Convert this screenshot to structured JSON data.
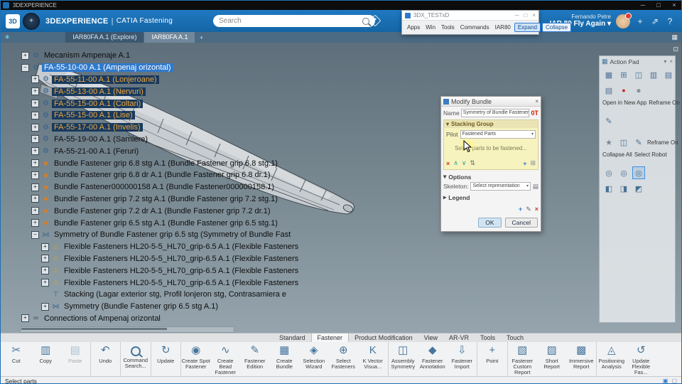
{
  "icons": {
    "minimize": "─",
    "maximize": "□",
    "close": "×",
    "caret_down": "▾",
    "caret_right": "▸",
    "plus": "+",
    "help": "?",
    "share": "⇗",
    "grid": "▦",
    "panel": "⊡",
    "home": "∗",
    "add_tab": "+",
    "logo": "3D",
    "compass": "+"
  },
  "titlebar": {
    "app": "3DEXPERIENCE"
  },
  "appbar": {
    "brand": "3DEXPERIENCE",
    "divider": "|",
    "app_name": "CATIA Fastening",
    "search_placeholder": "Search",
    "user_name": "Fernando Petre",
    "workspace": "IAR 80 Fly Again"
  },
  "floating_window": {
    "title": "3DX_TESTxD",
    "menus": [
      "Apps",
      "Win",
      "Tools",
      "Commands",
      "IAR80"
    ],
    "expand_label": "Expand",
    "collapse_label": "Collapse"
  },
  "view_tabs": {
    "items": [
      {
        "label": "IAR80FA A.1 (Explore)",
        "cls": ""
      },
      {
        "label": "IAR80FA A.1",
        "cls": "active"
      }
    ]
  },
  "tree": {
    "items": [
      {
        "label": "Mecanism Ampenaje A.1",
        "level": 1,
        "icon": "product",
        "exp": "plus",
        "cls": ""
      },
      {
        "label": "FA-55-10-00 A.1 (Ampenaj orizontal)",
        "level": 1,
        "icon": "product",
        "exp": "minus",
        "cls": "sel-bright"
      },
      {
        "label": "FA-55-11-00 A.1 (Lonjeroane)",
        "level": 2,
        "icon": "product",
        "exp": "plus",
        "cls": "sel-dark"
      },
      {
        "label": "FA-55-13-00 A.1 (Nervuri)",
        "level": 2,
        "icon": "product",
        "exp": "plus",
        "cls": "sel-dark"
      },
      {
        "label": "FA-55-15-00 A.1 (Coltari)",
        "level": 2,
        "icon": "product",
        "exp": "plus",
        "cls": "sel-dark"
      },
      {
        "label": "FA-55-15-00 A.1 (Lise)",
        "level": 2,
        "icon": "product",
        "exp": "plus",
        "cls": "sel-dark"
      },
      {
        "label": "FA-55-17-00 A.1 (Invelis)",
        "level": 2,
        "icon": "product",
        "exp": "plus",
        "cls": "sel-dark"
      },
      {
        "label": "FA-55-19-00 A.1 (Sarniere)",
        "level": 2,
        "icon": "product",
        "exp": "plus",
        "cls": ""
      },
      {
        "label": "FA-55-21-00 A.1 (Feruri)",
        "level": 2,
        "icon": "product",
        "exp": "plus",
        "cls": ""
      },
      {
        "label": "Bundle Fastener grip 6.8 stg A.1 (Bundle Fastener grip 6.8 stg.1)",
        "level": 2,
        "icon": "bundle",
        "exp": "plus",
        "cls": ""
      },
      {
        "label": "Bundle Fastener grip 6.8 dr A.1 (Bundle Fastener grip 6.8 dr.1)",
        "level": 2,
        "icon": "bundle",
        "exp": "plus",
        "cls": ""
      },
      {
        "label": "Bundle Fastener000000158 A.1 (Bundle Fastener000000158.1)",
        "level": 2,
        "icon": "bundle",
        "exp": "plus",
        "cls": ""
      },
      {
        "label": "Bundle Fastener grip 7.2 stg A.1 (Bundle Fastener grip 7.2 stg.1)",
        "level": 2,
        "icon": "bundle",
        "exp": "plus",
        "cls": ""
      },
      {
        "label": "Bundle Fastener grip 7.2 dr A.1 (Bundle Fastener grip 7.2 dr.1)",
        "level": 2,
        "icon": "bundle",
        "exp": "plus",
        "cls": ""
      },
      {
        "label": "Bundle Fastener grip 6.5 stg A.1 (Bundle Fastener grip 6.5 stg.1)",
        "level": 2,
        "icon": "bundle",
        "exp": "plus",
        "cls": ""
      },
      {
        "label": "Symmetry of Bundle Fastener grip 6.5 stg (Symmetry of Bundle Fast",
        "level": 2,
        "icon": "symmetry",
        "exp": "minus",
        "cls": ""
      },
      {
        "label": "Flexible Fasteners HL20-5-5_HL70_grip-6.5 A.1 (Flexible Fasteners",
        "level": 3,
        "icon": "flex",
        "exp": "plus",
        "cls": ""
      },
      {
        "label": "Flexible Fasteners HL20-5-5_HL70_grip-6.5 A.1 (Flexible Fasteners",
        "level": 3,
        "icon": "flex",
        "exp": "plus",
        "cls": ""
      },
      {
        "label": "Flexible Fasteners HL20-5-5_HL70_grip-6.5 A.1 (Flexible Fasteners",
        "level": 3,
        "icon": "flex",
        "exp": "plus",
        "cls": ""
      },
      {
        "label": "Flexible Fasteners HL20-5-5_HL70_grip-6.5 A.1 (Flexible Fasteners",
        "level": 3,
        "icon": "flex",
        "exp": "plus",
        "cls": ""
      },
      {
        "label": "Stacking (Lagar exterior stg, Profil lonjeron stg, Contrasamiera e",
        "level": 3,
        "icon": "stacking",
        "exp": "none",
        "cls": ""
      },
      {
        "label": "Symmetry (Bundle Fastener grip 6.5 stg A.1)",
        "level": 3,
        "icon": "symmetry",
        "exp": "plus",
        "cls": ""
      },
      {
        "label": "Connections of Ampenaj orizontal",
        "level": 1,
        "icon": "connections",
        "exp": "plus",
        "cls": ""
      }
    ]
  },
  "dialog": {
    "title": "Modify Bundle",
    "name_label": "Name",
    "name_value": "Symmetry of Bundle Fastener gri",
    "name_badge": "0T",
    "stacking_group_label": "Stacking Group",
    "pilot_label": "Pilot",
    "pilot_value": "Fastened Parts",
    "hint": "Select parts to be fastened...",
    "options_label": "Options",
    "skeleton_label": "Skeleton:",
    "skeleton_value": "Select representation",
    "legend_label": "Legend",
    "ok_label": "OK",
    "cancel_label": "Cancel"
  },
  "action_pad": {
    "title": "Action Pad",
    "open_in_new_app": "Open in New App",
    "reframe_on_a": "Reframe On",
    "reframe_on_b": "Reframe On",
    "collapse_all": "Collapse All",
    "select_robot": "Select Robot"
  },
  "ribbon": {
    "tabs": [
      {
        "label": "Standard",
        "cls": ""
      },
      {
        "label": "Fastener",
        "cls": "active"
      },
      {
        "label": "Product Modification",
        "cls": ""
      },
      {
        "label": "View",
        "cls": ""
      },
      {
        "label": "AR-VR",
        "cls": ""
      },
      {
        "label": "Tools",
        "cls": ""
      },
      {
        "label": "Touch",
        "cls": ""
      }
    ],
    "buttons": [
      {
        "label": "Cut",
        "glyph": "✂",
        "cls": "",
        "icon_cls": ""
      },
      {
        "label": "Copy",
        "glyph": "▥",
        "cls": "",
        "icon_cls": ""
      },
      {
        "label": "Paste",
        "glyph": "▤",
        "cls": "disabled",
        "icon_cls": ""
      },
      {
        "label": "Undo",
        "glyph": "↶",
        "cls": "sep",
        "icon_cls": ""
      },
      {
        "label": "Command Search...",
        "glyph": "",
        "cls": "sep",
        "icon_cls": "mag"
      },
      {
        "label": "Update",
        "glyph": "↻",
        "cls": "sep",
        "icon_cls": ""
      },
      {
        "label": "Create Spot Fastener",
        "glyph": "◉",
        "cls": "sep",
        "icon_cls": ""
      },
      {
        "label": "Create Bead Fastener",
        "glyph": "∿",
        "cls": "",
        "icon_cls": ""
      },
      {
        "label": "Fastener Edition",
        "glyph": "✎",
        "cls": "",
        "icon_cls": ""
      },
      {
        "label": "Create Bundle",
        "glyph": "▦",
        "cls": "",
        "icon_cls": ""
      },
      {
        "label": "Selection Wizard",
        "glyph": "◈",
        "cls": "",
        "icon_cls": ""
      },
      {
        "label": "Select Fasteners",
        "glyph": "⊕",
        "cls": "",
        "icon_cls": ""
      },
      {
        "label": "K Vector Visua...",
        "glyph": "K",
        "cls": "",
        "icon_cls": ""
      },
      {
        "label": "Assembly Symmetry",
        "glyph": "◫",
        "cls": "sep",
        "icon_cls": ""
      },
      {
        "label": "Fastener Annotation",
        "glyph": "◆",
        "cls": "",
        "icon_cls": ""
      },
      {
        "label": "Fastener Import",
        "glyph": "⇩",
        "cls": "",
        "icon_cls": ""
      },
      {
        "label": "Point",
        "glyph": "+",
        "cls": "sep",
        "icon_cls": ""
      },
      {
        "label": "Fastener Custom Report",
        "glyph": "▧",
        "cls": "sep",
        "icon_cls": ""
      },
      {
        "label": "Short Report",
        "glyph": "▨",
        "cls": "",
        "icon_cls": ""
      },
      {
        "label": "Immersive Report",
        "glyph": "▩",
        "cls": "",
        "icon_cls": ""
      },
      {
        "label": "Positioning Analysis",
        "glyph": "◬",
        "cls": "sep",
        "icon_cls": ""
      },
      {
        "label": "Update Flexible Fas...",
        "glyph": "↺",
        "cls": "",
        "icon_cls": ""
      }
    ]
  },
  "statusbar": {
    "message": "Select parts"
  }
}
